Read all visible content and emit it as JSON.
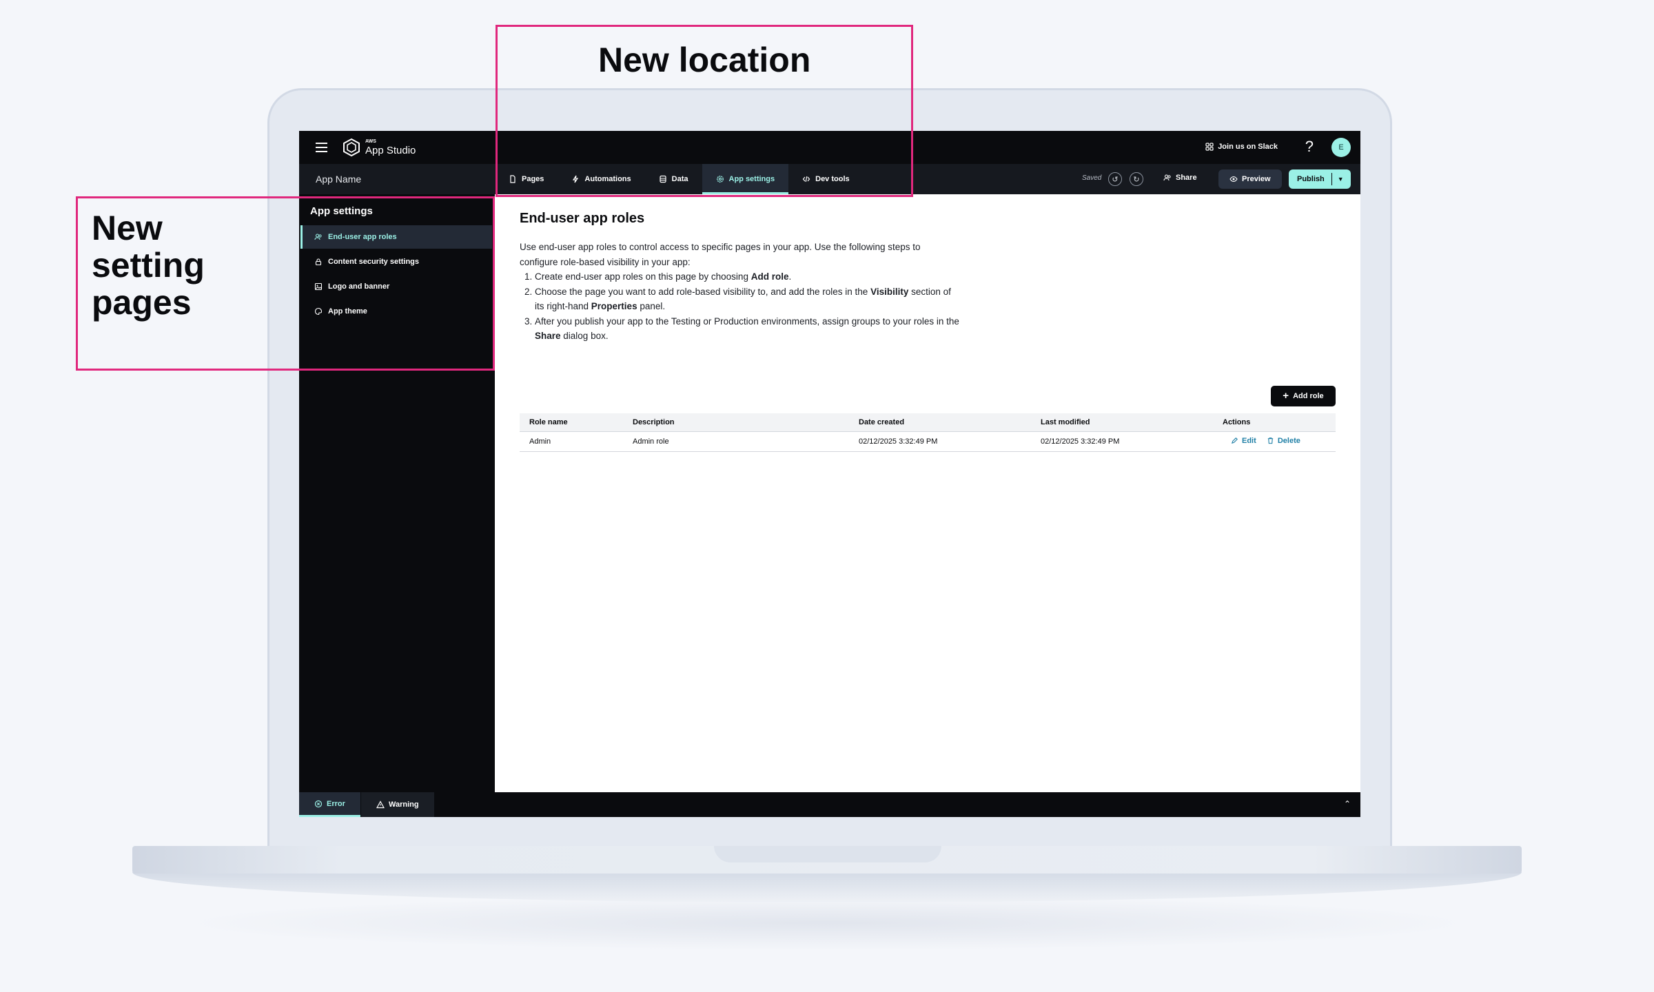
{
  "annotations": {
    "top_label": "New location",
    "left_label_line1": "New",
    "left_label_line2": "setting",
    "left_label_line3": "pages",
    "callout_color": "#e0287d"
  },
  "topbar": {
    "brand_small": "AWS",
    "brand": "App Studio",
    "slack": "Join us on Slack",
    "help": "?",
    "avatar": "E"
  },
  "subbar": {
    "app_name": "App Name",
    "tabs": [
      {
        "label": "Pages",
        "icon": "page-icon"
      },
      {
        "label": "Automations",
        "icon": "lightning-icon"
      },
      {
        "label": "Data",
        "icon": "database-icon"
      },
      {
        "label": "App settings",
        "icon": "gear-icon",
        "active": true
      },
      {
        "label": "Dev tools",
        "icon": "code-icon"
      }
    ],
    "saved": "Saved",
    "share": "Share",
    "preview": "Preview",
    "publish": "Publish"
  },
  "sidebar": {
    "title": "App settings",
    "items": [
      {
        "label": "End-user app roles",
        "active": true
      },
      {
        "label": "Content security settings"
      },
      {
        "label": "Logo and banner"
      },
      {
        "label": "App theme"
      }
    ]
  },
  "main": {
    "title": "End-user app roles",
    "intro_lead": "Use end-user app roles to control access to specific pages in your app. Use the following steps to configure role-based visibility in your app:",
    "step1_pre": "Create end-user app roles on this page by choosing ",
    "step1_bold": "Add role",
    "step1_post": ".",
    "step2_pre": "Choose the page you want to add role-based visibility to, and add the roles in the ",
    "step2_bold1": "Visibility",
    "step2_mid": " section of its right-hand ",
    "step2_bold2": "Properties",
    "step2_post": " panel.",
    "step3_pre": "After you publish your app to the Testing or Production environments, assign groups to your roles in the ",
    "step3_bold": "Share",
    "step3_post": " dialog box.",
    "add_role": "Add role",
    "table": {
      "headers": [
        "Role name",
        "Description",
        "Date created",
        "Last modified",
        "Actions"
      ],
      "rows": [
        {
          "role": "Admin",
          "description": "Admin role",
          "created": "02/12/2025 3:32:49 PM",
          "modified": "02/12/2025 3:32:49 PM",
          "edit": "Edit",
          "delete": "Delete"
        }
      ]
    }
  },
  "bottombar": {
    "error": "Error",
    "warning": "Warning",
    "collapse": "⌃"
  },
  "colors": {
    "accent": "#9bf0e6",
    "link": "#1f7fa6",
    "dark": "#0a0b0e"
  }
}
